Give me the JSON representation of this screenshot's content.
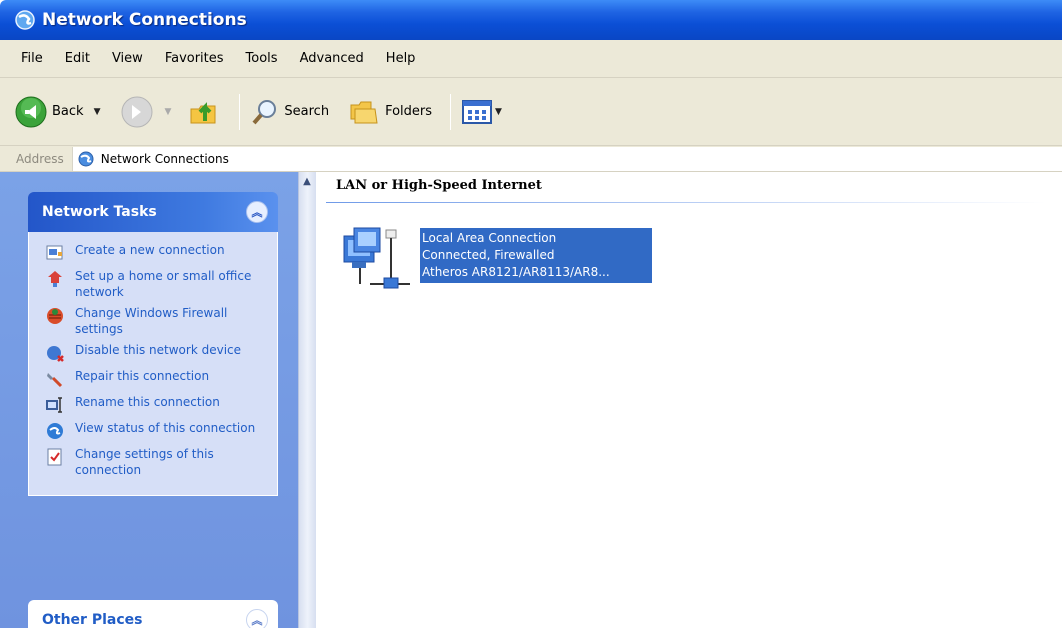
{
  "window": {
    "title": "Network Connections"
  },
  "menu": [
    "File",
    "Edit",
    "View",
    "Favorites",
    "Tools",
    "Advanced",
    "Help"
  ],
  "toolbar": {
    "back_label": "Back",
    "search_label": "Search",
    "folders_label": "Folders"
  },
  "address": {
    "label": "Address",
    "value": "Network Connections"
  },
  "tasks": {
    "header": "Network Tasks",
    "items": [
      {
        "label": "Create a new connection",
        "icon": "new-connection-icon"
      },
      {
        "label": "Set up a home or small office network",
        "icon": "home-network-icon"
      },
      {
        "label": "Change Windows Firewall settings",
        "icon": "firewall-icon"
      },
      {
        "label": "Disable this network device",
        "icon": "disable-device-icon"
      },
      {
        "label": "Repair this connection",
        "icon": "repair-icon"
      },
      {
        "label": "Rename this connection",
        "icon": "rename-icon"
      },
      {
        "label": "View status of this connection",
        "icon": "status-icon"
      },
      {
        "label": "Change settings of this connection",
        "icon": "settings-icon"
      }
    ]
  },
  "other_places": {
    "header": "Other Places"
  },
  "content": {
    "group_title": "LAN or High-Speed Internet",
    "connection": {
      "name": "Local Area Connection",
      "status": "Connected, Firewalled",
      "device": "Atheros AR8121/AR8113/AR8..."
    }
  },
  "colors": {
    "titlebar": "#0b4fd6",
    "selection": "#316ac5",
    "task_link": "#215dc6",
    "panel_bg": "#7ba2e7"
  }
}
